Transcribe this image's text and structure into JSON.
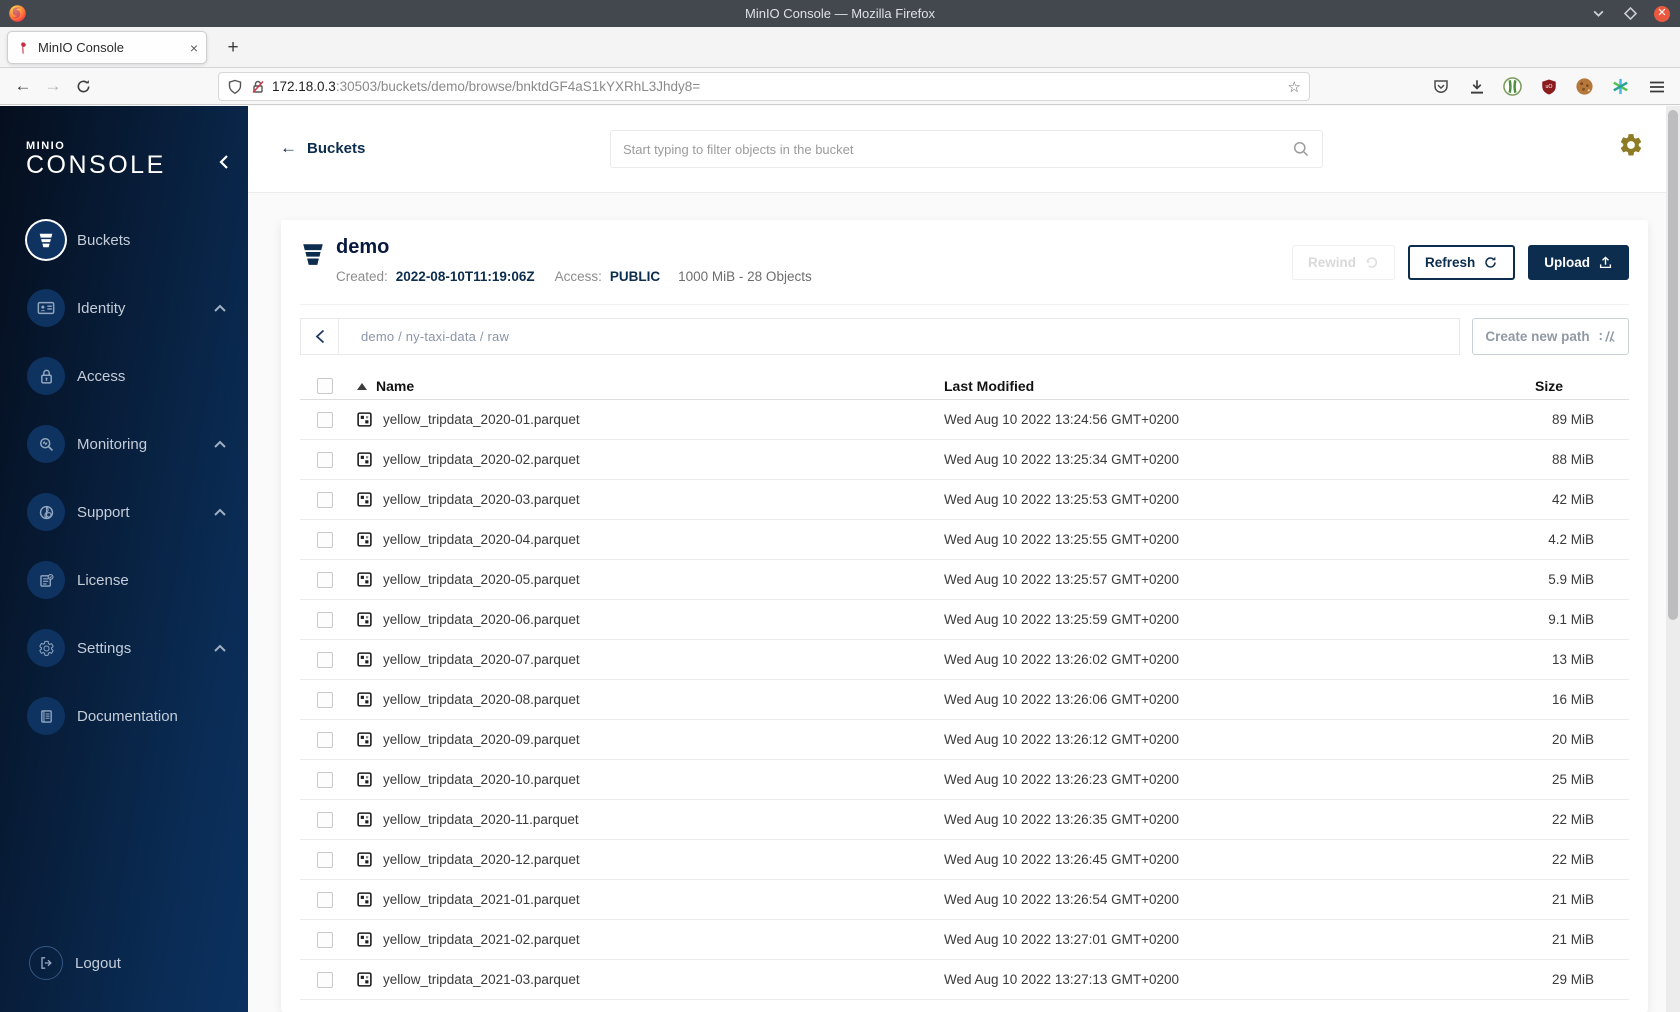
{
  "colors": {
    "primary_navy": "#0c2d4e",
    "sidebar_gradient_start": "#050e1d",
    "sidebar_gradient_end": "#0a2c55",
    "accent_gold": "#8d7b25",
    "close_button_orange": "#e9593f",
    "minio_red": "#c72c48"
  },
  "browser": {
    "window_title": "MinIO Console — Mozilla Firefox",
    "tab_title": "MinIO Console",
    "new_tab_button": "+",
    "tab_close": "×",
    "url_host": "172.18.0.3",
    "url_rest": ":30503/buckets/demo/browse/bnktdGF4aS1kYXRhL3Jhdy8=",
    "back_arrow": "←",
    "forward_arrow": "→",
    "star": "☆"
  },
  "sidebar": {
    "brand_top": "MINIO",
    "brand_main": "CONSOLE",
    "items": [
      {
        "label": "Buckets",
        "active": true
      },
      {
        "label": "Identity",
        "expandable": true
      },
      {
        "label": "Access"
      },
      {
        "label": "Monitoring",
        "expandable": true
      },
      {
        "label": "Support",
        "expandable": true
      },
      {
        "label": "License"
      },
      {
        "label": "Settings",
        "expandable": true
      },
      {
        "label": "Documentation"
      }
    ],
    "logout_label": "Logout"
  },
  "topbar": {
    "back_label": "Buckets",
    "back_arrow": "←",
    "search_placeholder": "Start typing to filter objects in the bucket"
  },
  "bucket": {
    "name": "demo",
    "created_label": "Created:",
    "created_value": "2022-08-10T11:19:06Z",
    "access_label": "Access:",
    "access_value": "PUBLIC",
    "usage": "1000 MiB - 28 Objects",
    "rewind_label": "Rewind",
    "refresh_label": "Refresh",
    "upload_label": "Upload"
  },
  "path_bar": {
    "path": "demo / ny-taxi-data / raw",
    "create_label": "Create new path"
  },
  "table": {
    "headers": {
      "name": "Name",
      "modified": "Last Modified",
      "size": "Size"
    },
    "rows": [
      {
        "name": "yellow_tripdata_2020-01.parquet",
        "modified": "Wed Aug 10 2022 13:24:56 GMT+0200",
        "size": "89 MiB"
      },
      {
        "name": "yellow_tripdata_2020-02.parquet",
        "modified": "Wed Aug 10 2022 13:25:34 GMT+0200",
        "size": "88 MiB"
      },
      {
        "name": "yellow_tripdata_2020-03.parquet",
        "modified": "Wed Aug 10 2022 13:25:53 GMT+0200",
        "size": "42 MiB"
      },
      {
        "name": "yellow_tripdata_2020-04.parquet",
        "modified": "Wed Aug 10 2022 13:25:55 GMT+0200",
        "size": "4.2 MiB"
      },
      {
        "name": "yellow_tripdata_2020-05.parquet",
        "modified": "Wed Aug 10 2022 13:25:57 GMT+0200",
        "size": "5.9 MiB"
      },
      {
        "name": "yellow_tripdata_2020-06.parquet",
        "modified": "Wed Aug 10 2022 13:25:59 GMT+0200",
        "size": "9.1 MiB"
      },
      {
        "name": "yellow_tripdata_2020-07.parquet",
        "modified": "Wed Aug 10 2022 13:26:02 GMT+0200",
        "size": "13 MiB"
      },
      {
        "name": "yellow_tripdata_2020-08.parquet",
        "modified": "Wed Aug 10 2022 13:26:06 GMT+0200",
        "size": "16 MiB"
      },
      {
        "name": "yellow_tripdata_2020-09.parquet",
        "modified": "Wed Aug 10 2022 13:26:12 GMT+0200",
        "size": "20 MiB"
      },
      {
        "name": "yellow_tripdata_2020-10.parquet",
        "modified": "Wed Aug 10 2022 13:26:23 GMT+0200",
        "size": "25 MiB"
      },
      {
        "name": "yellow_tripdata_2020-11.parquet",
        "modified": "Wed Aug 10 2022 13:26:35 GMT+0200",
        "size": "22 MiB"
      },
      {
        "name": "yellow_tripdata_2020-12.parquet",
        "modified": "Wed Aug 10 2022 13:26:45 GMT+0200",
        "size": "22 MiB"
      },
      {
        "name": "yellow_tripdata_2021-01.parquet",
        "modified": "Wed Aug 10 2022 13:26:54 GMT+0200",
        "size": "21 MiB"
      },
      {
        "name": "yellow_tripdata_2021-02.parquet",
        "modified": "Wed Aug 10 2022 13:27:01 GMT+0200",
        "size": "21 MiB"
      },
      {
        "name": "yellow_tripdata_2021-03.parquet",
        "modified": "Wed Aug 10 2022 13:27:13 GMT+0200",
        "size": "29 MiB"
      }
    ]
  }
}
